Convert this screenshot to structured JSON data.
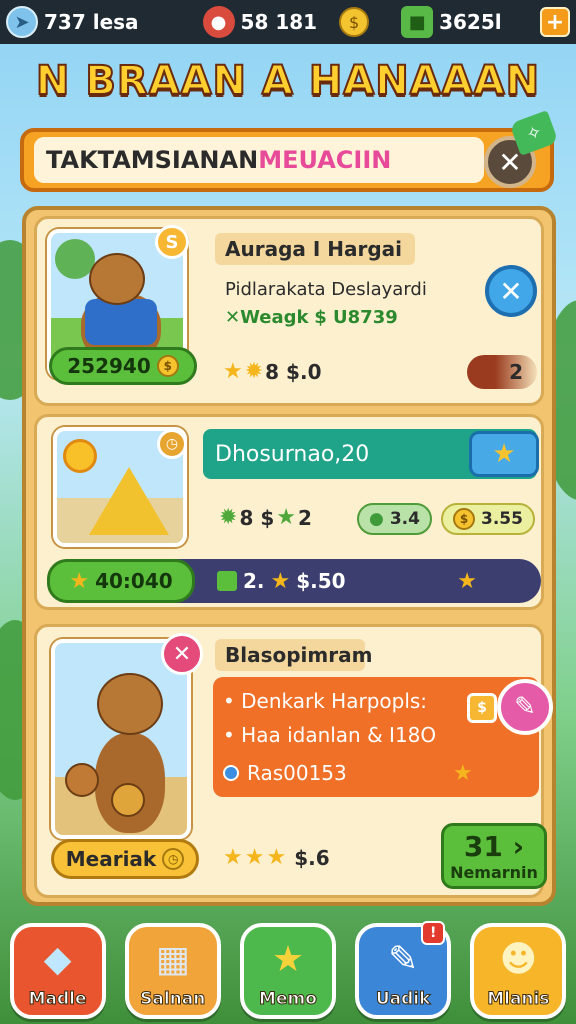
{
  "topbar": {
    "resource1": "737 lesa",
    "resource2": "58 181",
    "resource4": "3625l",
    "plus": "+"
  },
  "title": "N BRAAN A HANAAAN",
  "banner": {
    "text_dark": "TAKTAMSIANAN ",
    "text_pink": "MEUACIIN",
    "close": "✕"
  },
  "card1": {
    "title": "Auraga I Hargai",
    "line1": "Pidlarakata Deslayardi",
    "line2_prefix": "✕Weagk",
    "line2_value": "$ U8739",
    "price_pill": "252940",
    "stars_text": "8 $.0",
    "count": "2",
    "coin_badge": "S"
  },
  "card2": {
    "header": "Dhosurnao,20",
    "stars_text": "8 $",
    "stars_suffix": "2",
    "pill_a": "3.4",
    "pill_b": "3.55",
    "price_pill": "40:040",
    "bar_text": "2.",
    "bar_value": "$.50"
  },
  "card3": {
    "title": "Blasopimram",
    "line1": "• Denkark Harpopls:",
    "line2": "• Haa idanlan & I18O",
    "line3": "Ras00153",
    "yellow_pill": "Meariak",
    "stars_text": "$.6",
    "next_number": "31",
    "next_label": "Nemarnin"
  },
  "nav": [
    {
      "label": "Madle",
      "icon": "◆",
      "color": "#e8552e"
    },
    {
      "label": "Salnan",
      "icon": "▦",
      "color": "#f0a43a"
    },
    {
      "label": "Memo",
      "icon": "★",
      "color": "#4db84b"
    },
    {
      "label": "Uadik",
      "icon": "✎",
      "color": "#3c86d8",
      "notif": "!"
    },
    {
      "label": "Mlanis",
      "icon": "☻",
      "color": "#f7b62a"
    }
  ]
}
